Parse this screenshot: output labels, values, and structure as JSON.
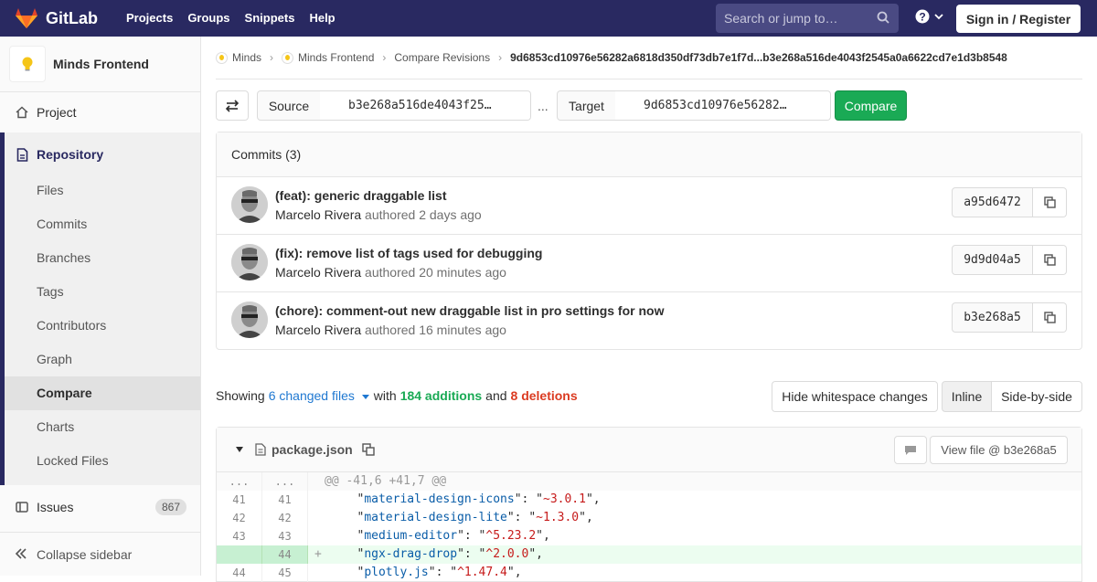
{
  "navbar": {
    "logo_text": "GitLab",
    "links": [
      "Projects",
      "Groups",
      "Snippets",
      "Help"
    ],
    "search_placeholder": "Search or jump to…",
    "signin_label": "Sign in / Register",
    "colors": {
      "navbar_bg": "#292961",
      "accent": "#1aaa55"
    }
  },
  "sidebar": {
    "project_name": "Minds Frontend",
    "project_label": "Project",
    "repository_label": "Repository",
    "repo_items": [
      "Files",
      "Commits",
      "Branches",
      "Tags",
      "Contributors",
      "Graph",
      "Compare",
      "Charts",
      "Locked Files"
    ],
    "active_item": "Compare",
    "issues_label": "Issues",
    "issues_count": "867",
    "collapse_label": "Collapse sidebar"
  },
  "breadcrumb": {
    "items": [
      "Minds",
      "Minds Frontend",
      "Compare Revisions"
    ],
    "current": "9d6853cd10976e56282a6818d350df73db7e1f7d...b3e268a516de4043f2545a0a6622cd7e1d3b8548"
  },
  "compare_form": {
    "source_label": "Source",
    "source_value": "b3e268a516de4043f25…",
    "separator": "...",
    "target_label": "Target",
    "target_value": "9d6853cd10976e56282…",
    "compare_label": "Compare"
  },
  "commits": {
    "header": "Commits (3)",
    "items": [
      {
        "title": "(feat): generic draggable list",
        "author": "Marcelo Rivera",
        "action": "authored",
        "time": "2 days ago",
        "sha": "a95d6472"
      },
      {
        "title": "(fix): remove list of tags used for debugging",
        "author": "Marcelo Rivera",
        "action": "authored",
        "time": "20 minutes ago",
        "sha": "9d9d04a5"
      },
      {
        "title": "(chore): comment-out new draggable list in pro settings for now",
        "author": "Marcelo Rivera",
        "action": "authored",
        "time": "16 minutes ago",
        "sha": "b3e268a5"
      }
    ]
  },
  "stats": {
    "showing": "Showing",
    "changed_files": "6 changed files",
    "with": "with",
    "additions": "184 additions",
    "and": "and",
    "deletions": "8 deletions",
    "hide_whitespace": "Hide whitespace changes",
    "inline": "Inline",
    "side_by_side": "Side-by-side"
  },
  "diff": {
    "file_name": "package.json",
    "view_file": "View file @ b3e268a5",
    "hunk": {
      "old": "...",
      "new": "...",
      "text": "@@ -41,6 +41,7 @@"
    },
    "lines": [
      {
        "old": "41",
        "new": "41",
        "sign": "",
        "key": "material-design-icons",
        "value": "~3.0.1",
        "type": "context"
      },
      {
        "old": "42",
        "new": "42",
        "sign": "",
        "key": "material-design-lite",
        "value": "~1.3.0",
        "type": "context"
      },
      {
        "old": "43",
        "new": "43",
        "sign": "",
        "key": "medium-editor",
        "value": "^5.23.2",
        "type": "context"
      },
      {
        "old": "",
        "new": "44",
        "sign": "+",
        "key": "ngx-drag-drop",
        "value": "^2.0.0",
        "type": "added"
      },
      {
        "old": "44",
        "new": "45",
        "sign": "",
        "key": "plotly.js",
        "value": "^1.47.4",
        "type": "context"
      }
    ]
  }
}
